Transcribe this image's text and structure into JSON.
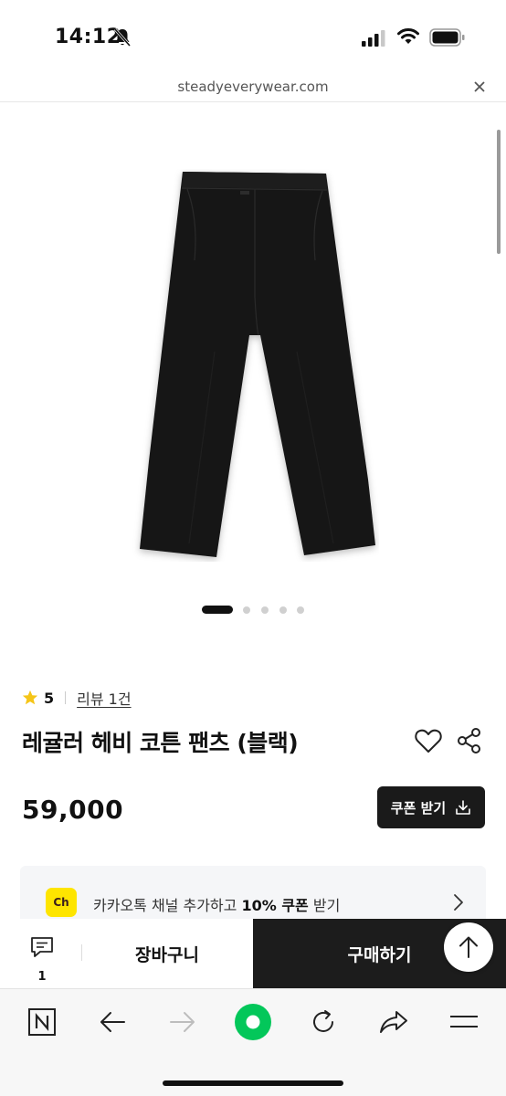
{
  "status_bar": {
    "time": "14:12"
  },
  "url_bar": {
    "domain": "steadyeverywear.com"
  },
  "product": {
    "rating": "5",
    "review_link": "리뷰 1건",
    "title": "레귤러 헤비 코튼 팬츠 (블랙)",
    "price": "59,000",
    "coupon_button": "쿠폰 받기",
    "image_dots": 5,
    "active_dot": 0
  },
  "kakao_banner": {
    "icon_label": "Ch",
    "text_prefix": "카카오톡 채널 추가하고 ",
    "text_bold": "10% 쿠폰",
    "text_suffix": " 받기"
  },
  "buy_bar": {
    "comment_count": "1",
    "cart_label": "장바구니",
    "buy_label": "구매하기"
  },
  "colors": {
    "kakao_yellow": "#FEE500",
    "buy_button_bg": "#1c1c1c",
    "naver_green": "#03C75A",
    "star": "#F5C518"
  },
  "browser_toolbar": {
    "icons": [
      "naver-n-icon",
      "back-arrow-icon",
      "forward-arrow-icon",
      "naver-home-icon",
      "refresh-icon",
      "share-arrow-icon",
      "menu-icon"
    ]
  }
}
